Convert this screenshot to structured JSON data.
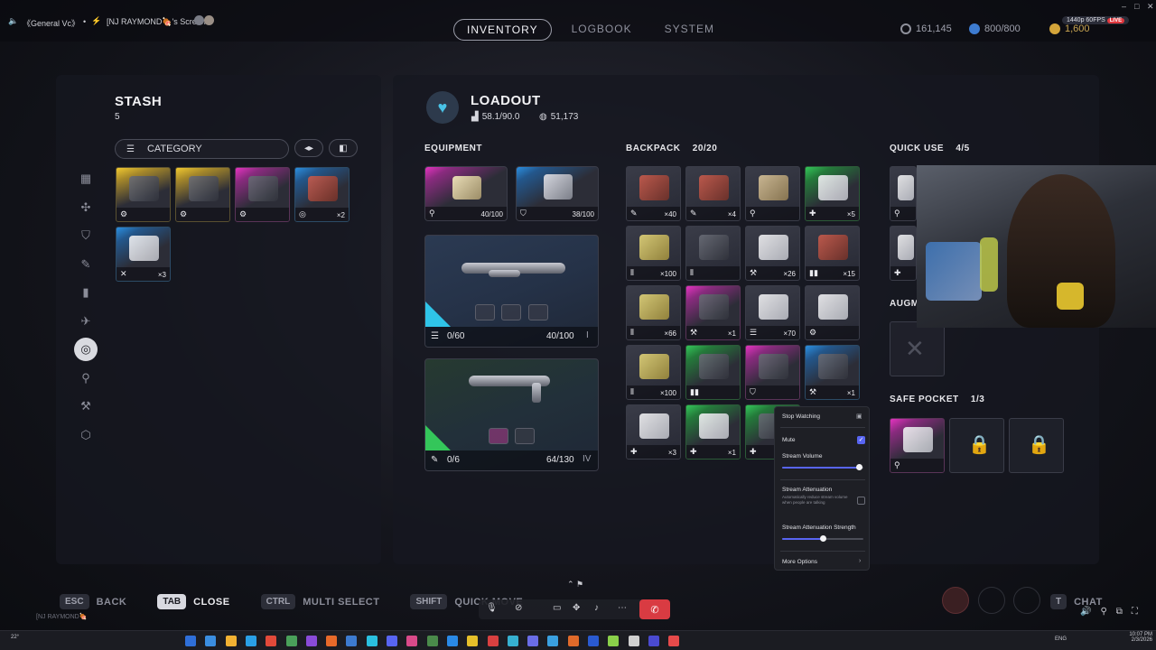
{
  "discord": {
    "channel": "《General Vc》",
    "screen": "[NJ RAYMOND🍖's Screen",
    "live_quality": "1440p 60FPS",
    "live_tag": "LIVE",
    "win_min": "–",
    "win_max": "□",
    "win_close": "✕"
  },
  "nav": {
    "tabs": [
      "INVENTORY",
      "LOGBOOK",
      "SYSTEM"
    ],
    "active": 0
  },
  "currency": {
    "coins": "161,145",
    "tokens": "800/800",
    "credits": "1,600"
  },
  "stash": {
    "title": "STASH",
    "count": "5",
    "category_label": "CATEGORY",
    "items": [
      {
        "rarity": "yellow",
        "art": "dark",
        "qty": ""
      },
      {
        "rarity": "yellow",
        "art": "dark",
        "qty": ""
      },
      {
        "rarity": "pink",
        "art": "dark",
        "qty": ""
      },
      {
        "rarity": "blue",
        "art": "red",
        "qty": "×2"
      },
      {
        "rarity": "blue",
        "art": "white",
        "qty": "×3"
      }
    ]
  },
  "loadout": {
    "title": "LOADOUT",
    "weight": "58.1/90.0",
    "value": "51,173",
    "equipment_label": "EQUIPMENT",
    "equip": [
      {
        "rarity": "pink",
        "value": "40/100"
      },
      {
        "rarity": "blue",
        "value": "38/100"
      }
    ],
    "weapon1": {
      "ammo": "0/60",
      "durability": "40/100",
      "tier": "I"
    },
    "weapon2": {
      "ammo": "0/6",
      "durability": "64/130",
      "tier": "IV"
    }
  },
  "backpack": {
    "label": "BACKPACK",
    "count": "20/20",
    "items": [
      {
        "rarity": "",
        "art": "red",
        "qty": "×40"
      },
      {
        "rarity": "",
        "art": "red",
        "qty": "×4"
      },
      {
        "rarity": "",
        "art": "tan",
        "qty": ""
      },
      {
        "rarity": "green",
        "art": "white",
        "qty": "×5"
      },
      {
        "rarity": "",
        "art": "gold",
        "qty": "×100"
      },
      {
        "rarity": "",
        "art": "dark",
        "qty": ""
      },
      {
        "rarity": "",
        "art": "white",
        "qty": "×26"
      },
      {
        "rarity": "",
        "art": "red",
        "qty": "×15"
      },
      {
        "rarity": "",
        "art": "gold",
        "qty": "×66"
      },
      {
        "rarity": "pink",
        "art": "dark",
        "qty": "×1"
      },
      {
        "rarity": "",
        "art": "white",
        "qty": "×70"
      },
      {
        "rarity": "",
        "art": "white",
        "qty": ""
      },
      {
        "rarity": "",
        "art": "gold",
        "qty": "×100"
      },
      {
        "rarity": "green",
        "art": "dark",
        "qty": ""
      },
      {
        "rarity": "pink",
        "art": "dark",
        "qty": ""
      },
      {
        "rarity": "blue",
        "art": "dark",
        "qty": "×1"
      },
      {
        "rarity": "",
        "art": "white",
        "qty": "×3"
      },
      {
        "rarity": "green",
        "art": "white",
        "qty": "×1"
      },
      {
        "rarity": "green",
        "art": "dark",
        "qty": "×1"
      }
    ]
  },
  "quick_use": {
    "label": "QUICK USE",
    "count": "4/5"
  },
  "augment": {
    "label": "AUGM"
  },
  "safe_pocket": {
    "label": "SAFE POCKET",
    "count": "1/3"
  },
  "stream_menu": {
    "stop_watching": "Stop Watching",
    "mute": "Mute",
    "stream_volume": "Stream Volume",
    "stream_attenuation": "Stream Attenuation",
    "attenuation_desc": "Automatically reduce stream volume when people are talking",
    "attenuation_strength": "Stream Attenuation Strength",
    "more_options": "More Options",
    "volume_level": 0.95,
    "attenuation_level": 0.5
  },
  "hints": [
    {
      "key": "ESC",
      "label": "BACK",
      "bright": false
    },
    {
      "key": "TAB",
      "label": "CLOSE",
      "bright": true
    },
    {
      "key": "CTRL",
      "label": "MULTI SELECT",
      "bright": false
    },
    {
      "key": "SHIFT",
      "label": "QUICK MOVE",
      "bright": false
    }
  ],
  "right_hint": {
    "key": "T",
    "label": "CHAT"
  },
  "overlay_user": "[NJ RAYMOND🍖",
  "taskbar": {
    "weather": "22°",
    "lang": "ENG",
    "time": "10:07 PM",
    "date": "2/3/2026"
  }
}
